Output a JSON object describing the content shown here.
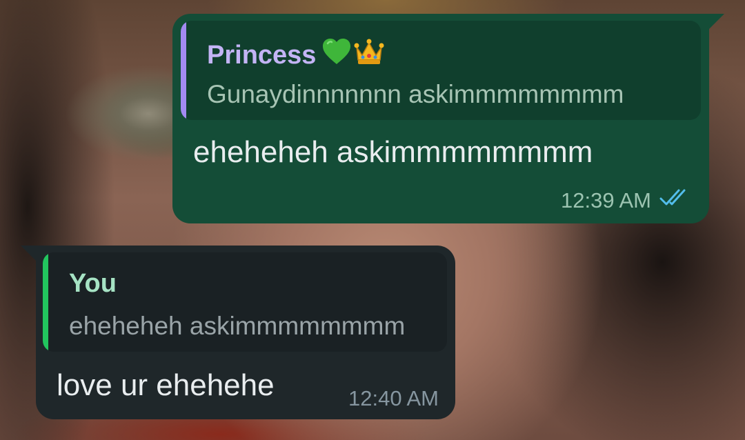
{
  "colors": {
    "outgoing_bubble": "#144d37",
    "outgoing_quote_bg": "#103f2d",
    "incoming_bubble": "#1f272a",
    "incoming_quote_bg": "#1a2124",
    "message_text": "#e9edef",
    "timestamp_outgoing": "#9cc4b1",
    "timestamp_incoming": "#8696a0",
    "read_ticks": "#53bdeb"
  },
  "messages": [
    {
      "direction": "outgoing",
      "quote": {
        "author": "Princess",
        "author_emojis": [
          "green-heart-icon",
          "crown-icon"
        ],
        "author_color": "#c3b4f5",
        "bar_color": "#a38af2",
        "preview": "Gunaydinnnnnnn askimmmmmmmm",
        "preview_color": "#a7c4b4"
      },
      "text": "eheheheh askimmmmmmmm",
      "time": "12:39 AM",
      "status_icon": "double-check-read-icon"
    },
    {
      "direction": "incoming",
      "quote": {
        "author": "You",
        "author_color": "#a6e3c4",
        "bar_color": "#22c55e",
        "preview": "eheheheh askimmmmmmmm",
        "preview_color": "#9aa4a8"
      },
      "text": "love ur ehehehe",
      "time": "12:40 AM"
    }
  ]
}
